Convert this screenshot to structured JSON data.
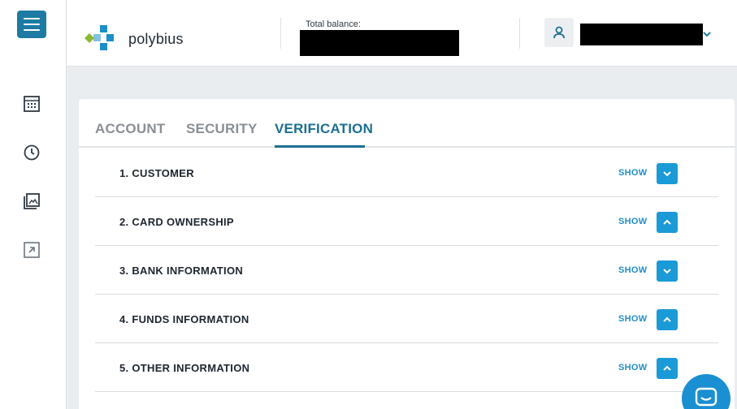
{
  "app": {
    "logo_text": "polybius"
  },
  "header": {
    "balance_label": "Total balance:",
    "balance_value": "",
    "user_name": ""
  },
  "tabs": [
    {
      "label": "ACCOUNT",
      "active": false
    },
    {
      "label": "SECURITY",
      "active": false
    },
    {
      "label": "VERIFICATION",
      "active": true
    }
  ],
  "sections": [
    {
      "title": "1. CUSTOMER",
      "action": "SHOW",
      "toggle": "chevron-down-icon"
    },
    {
      "title": "2. CARD OWNERSHIP",
      "action": "SHOW",
      "toggle": "chevron-up-icon"
    },
    {
      "title": "3. BANK INFORMATION",
      "action": "SHOW",
      "toggle": "chevron-down-icon"
    },
    {
      "title": "4. FUNDS INFORMATION",
      "action": "SHOW",
      "toggle": "chevron-up-icon"
    },
    {
      "title": "5. OTHER INFORMATION",
      "action": "SHOW",
      "toggle": "chevron-up-icon"
    }
  ],
  "rail": {
    "items": [
      "calculator-icon",
      "clock-icon",
      "gallery-icon",
      "external-link-icon"
    ]
  },
  "colors": {
    "primary": "#1d7aa3",
    "accent": "#1a9ad6",
    "logo_green": "#8cb832",
    "logo_blue": "#1b8fc7"
  }
}
